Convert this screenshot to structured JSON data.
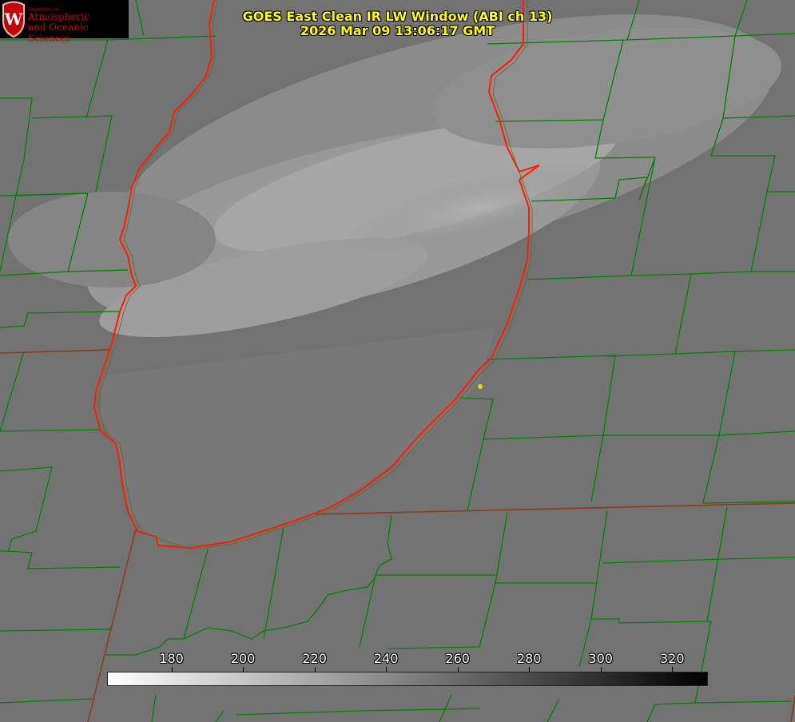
{
  "title": {
    "line1": "GOES East Clean IR LW Window (ABI ch 13)",
    "line2": "2026 Mar 09 13:06:17 GMT"
  },
  "logo": {
    "dept": "Department of",
    "line1": "Atmospheric",
    "line2": "and Oceanic Sciences",
    "letter": "W"
  },
  "colorbar": {
    "min": 162,
    "max": 330,
    "ticks": [
      "180",
      "200",
      "220",
      "240",
      "260",
      "280",
      "300",
      "320"
    ],
    "tick_values": [
      180,
      200,
      220,
      240,
      260,
      280,
      300,
      320
    ]
  },
  "colors": {
    "title": "#ffff00",
    "county_lines": "#008000",
    "state_lines": "#a0522d",
    "coastline": "#ff0000",
    "marker": "#e5d615"
  }
}
